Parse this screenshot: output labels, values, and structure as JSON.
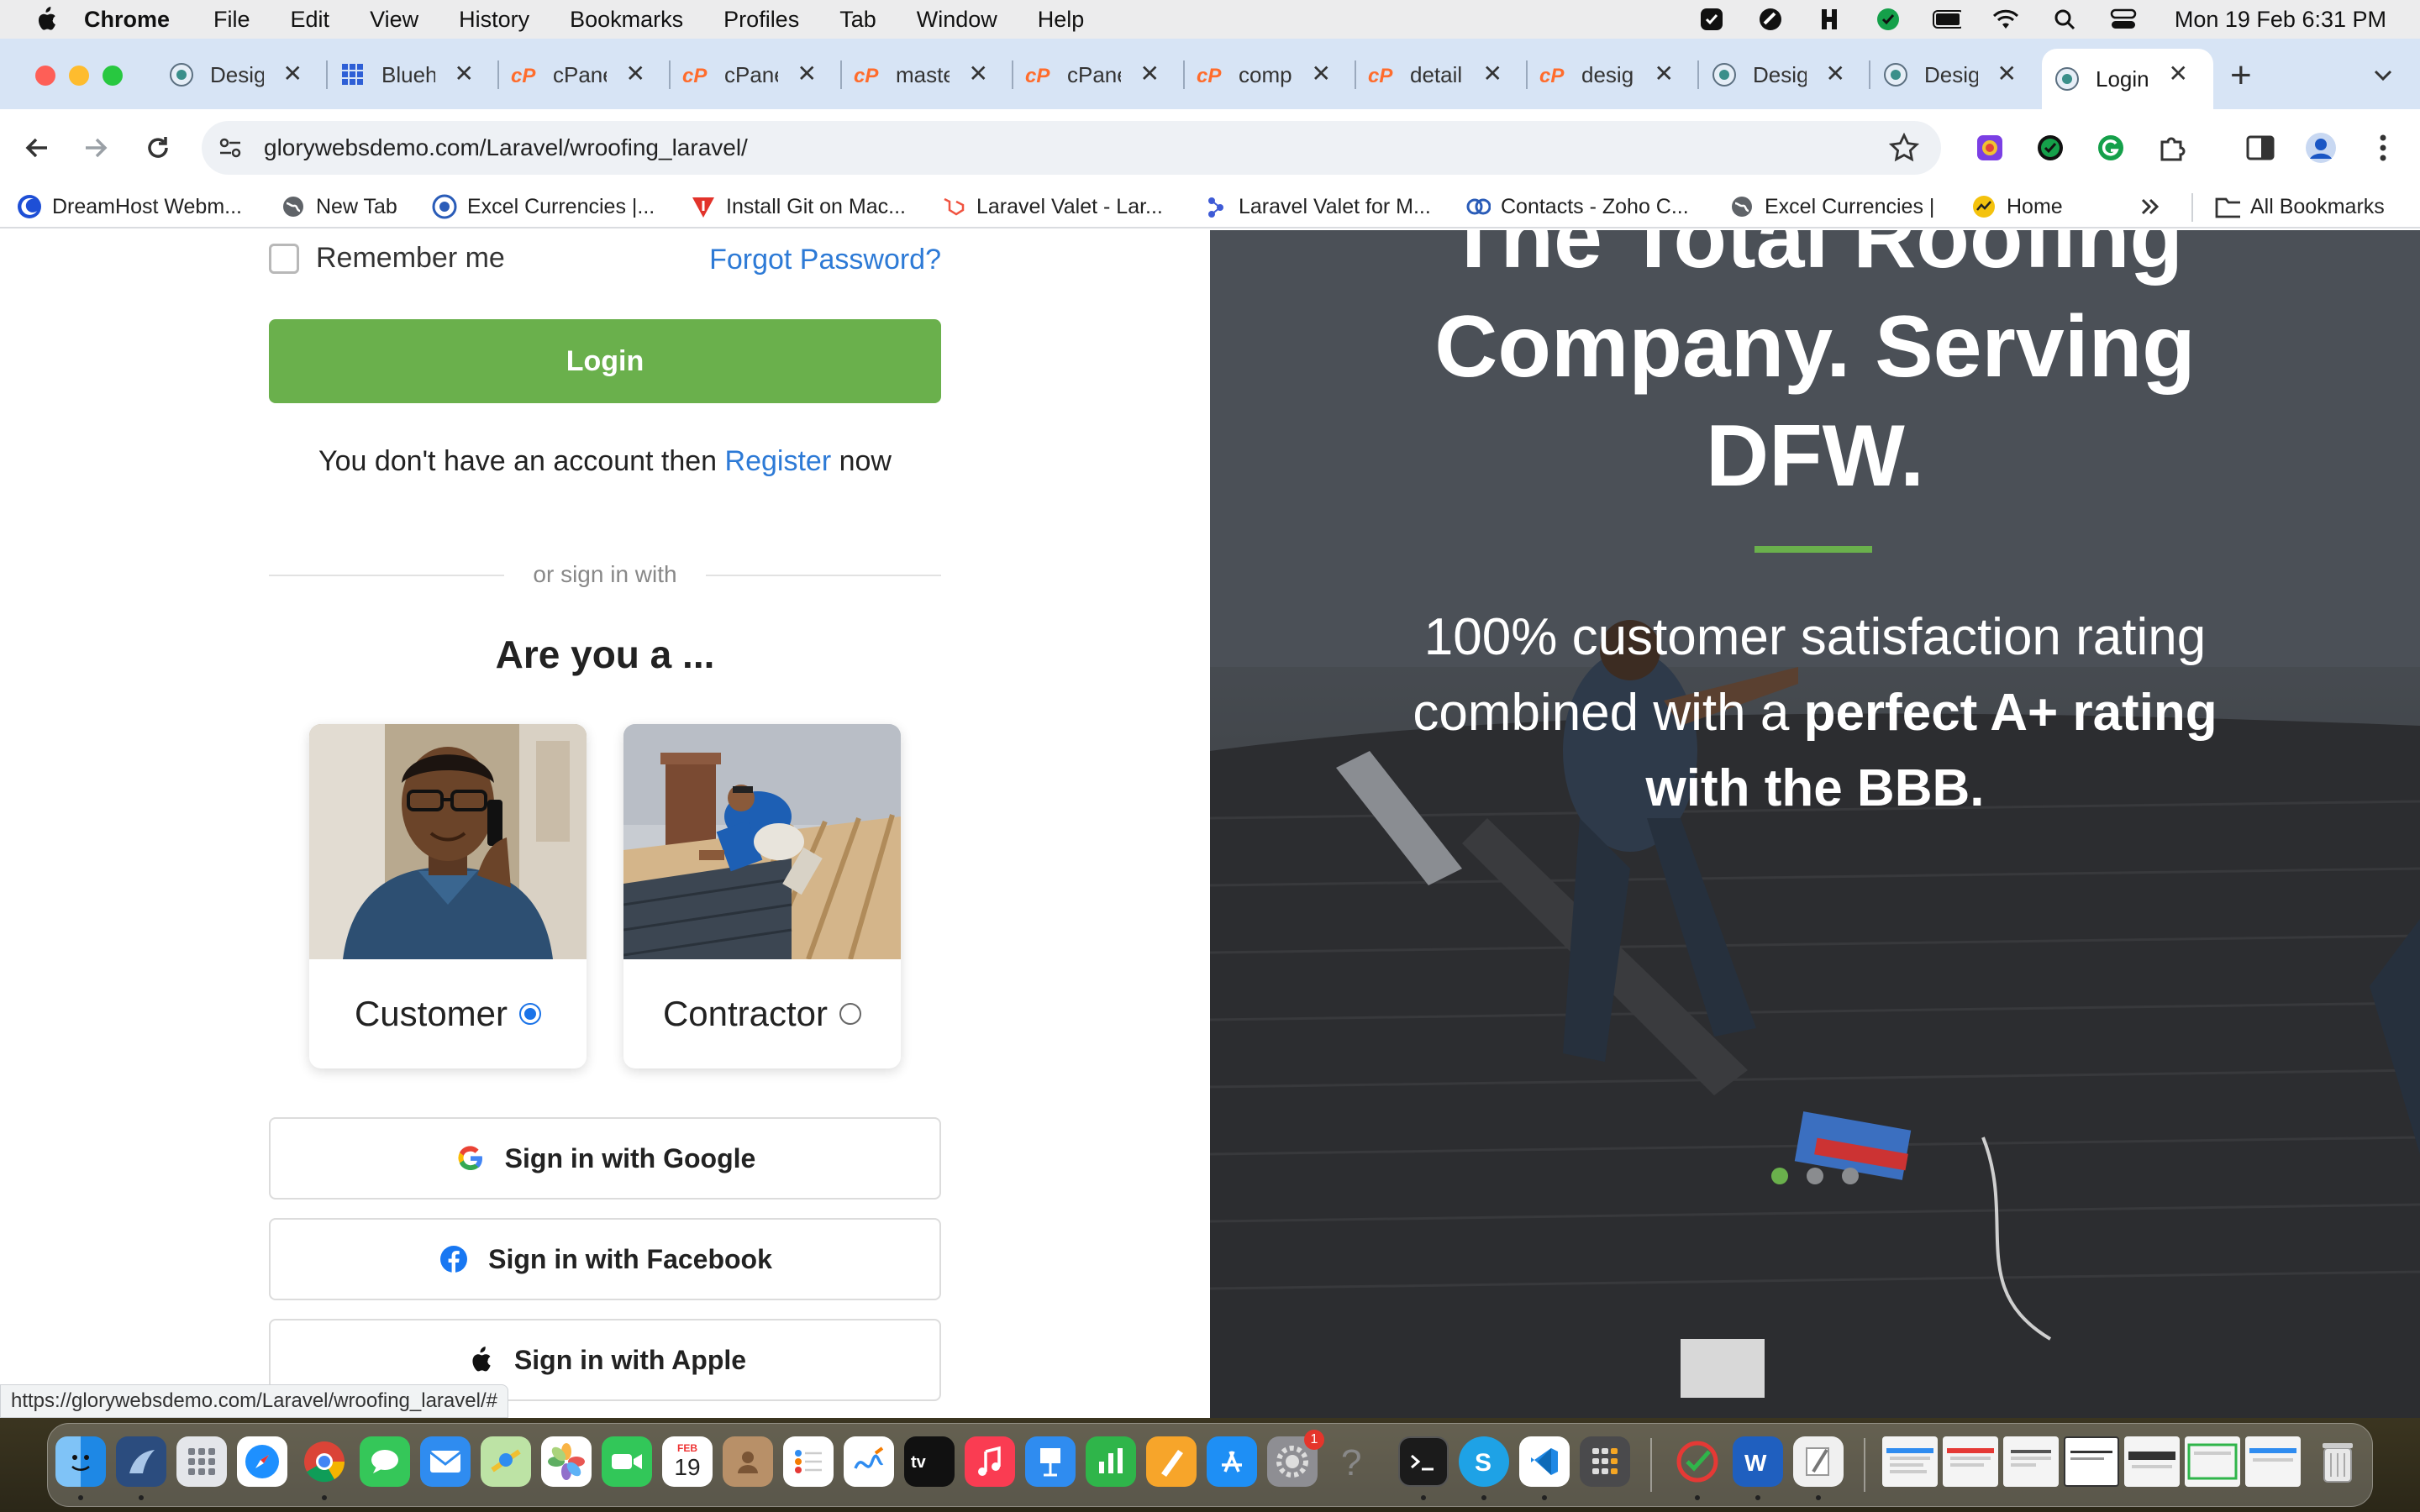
{
  "menubar": {
    "items": [
      "Chrome",
      "File",
      "Edit",
      "View",
      "History",
      "Bookmarks",
      "Profiles",
      "Tab",
      "Window",
      "Help"
    ],
    "clock": "Mon 19 Feb  6:31 PM"
  },
  "tabs": [
    {
      "title": "Desig",
      "icon": "wordpress-icon"
    },
    {
      "title": "Blueh",
      "icon": "grid-icon"
    },
    {
      "title": "cPane",
      "icon": "cpanel-icon"
    },
    {
      "title": "cPane",
      "icon": "cpanel-icon"
    },
    {
      "title": "maste",
      "icon": "cpanel-icon"
    },
    {
      "title": "cPane",
      "icon": "cpanel-icon"
    },
    {
      "title": "comp",
      "icon": "cpanel-icon"
    },
    {
      "title": "detail",
      "icon": "cpanel-icon"
    },
    {
      "title": "desig",
      "icon": "cpanel-icon"
    },
    {
      "title": "Desig",
      "icon": "wordpress-icon"
    },
    {
      "title": "Desig",
      "icon": "wordpress-icon"
    },
    {
      "title": "Login",
      "icon": "wordpress-icon"
    }
  ],
  "toolbar": {
    "url": "glorywebsdemo.com/Laravel/wroofing_laravel/"
  },
  "bookmarks": [
    {
      "label": "DreamHost Webm...",
      "icon": "dreamhost-icon"
    },
    {
      "label": "New Tab",
      "icon": "globe-icon"
    },
    {
      "label": "Excel Currencies |...",
      "icon": "excel-currency-icon"
    },
    {
      "label": "Install Git on Mac...",
      "icon": "git-icon"
    },
    {
      "label": "Laravel Valet - Lar...",
      "icon": "laravel-icon"
    },
    {
      "label": "Laravel Valet for M...",
      "icon": "valet-icon"
    },
    {
      "label": "Contacts - Zoho C...",
      "icon": "zoho-icon"
    },
    {
      "label": "Excel Currencies |",
      "icon": "globe-icon"
    },
    {
      "label": "Home",
      "icon": "home-icon"
    }
  ],
  "all_bookmarks_label": "All Bookmarks",
  "form": {
    "remember_label": "Remember me",
    "forgot_label": "Forgot Password?",
    "login_label": "Login",
    "register_prefix": "You don't have an account then",
    "register_link": "Register",
    "register_suffix": "now",
    "divider_text": "or sign in with",
    "role_heading": "Are you a ...",
    "roles": [
      {
        "label": "Customer",
        "selected": true
      },
      {
        "label": "Contractor",
        "selected": false
      }
    ],
    "social": [
      {
        "label": "Sign in with Google",
        "icon": "google-icon"
      },
      {
        "label": "Sign in with Facebook",
        "icon": "facebook-icon"
      },
      {
        "label": "Sign in with Apple",
        "icon": "apple-icon"
      }
    ]
  },
  "hero": {
    "title_line1": "The Total Roofing",
    "title_line2": "Company. Serving",
    "title_line3": "DFW.",
    "text_normal": "100% customer satisfaction rating combined with a",
    "text_bold": "perfect A+ rating with the BBB.",
    "slides": 3,
    "active_slide": 1
  },
  "status_url": "https://glorywebsdemo.com/Laravel/wroofing_laravel/#",
  "dock": {
    "calendar_month": "FEB",
    "calendar_day": "19",
    "badge_count": "1",
    "apps": [
      "finder",
      "dbeaver",
      "launchpad",
      "safari",
      "chrome",
      "messages",
      "mail",
      "maps",
      "photos",
      "facetime",
      "calendar",
      "contacts",
      "reminders",
      "freeform",
      "tv",
      "music",
      "keynote",
      "numbers",
      "pages",
      "app-store",
      "system-settings",
      "help",
      "terminal",
      "skype",
      "vscode",
      "calculator",
      "tasks",
      "word",
      "script-editor"
    ]
  },
  "colors": {
    "brand_green": "#6ab04c",
    "link_blue": "#2d7ad6",
    "tabstrip_bg": "#d7e4f5"
  }
}
